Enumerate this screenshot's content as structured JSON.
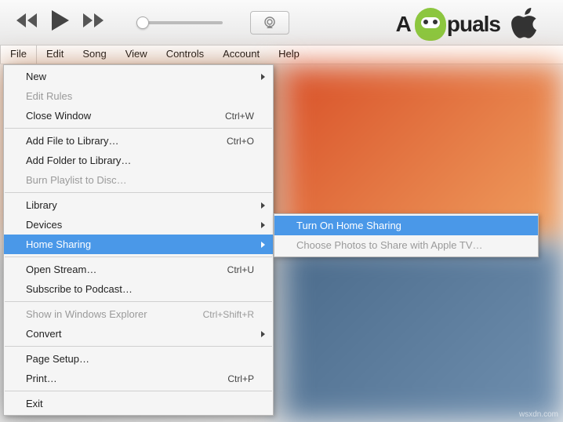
{
  "watermark": "wsxdn.com",
  "brand": {
    "name": "Appuals"
  },
  "menubar": {
    "items": [
      {
        "label": "File",
        "active": true
      },
      {
        "label": "Edit"
      },
      {
        "label": "Song"
      },
      {
        "label": "View"
      },
      {
        "label": "Controls"
      },
      {
        "label": "Account"
      },
      {
        "label": "Help"
      }
    ]
  },
  "file_menu": {
    "items": [
      {
        "label": "New",
        "submenu": true
      },
      {
        "label": "Edit Rules",
        "disabled": true
      },
      {
        "label": "Close Window",
        "shortcut": "Ctrl+W"
      },
      {
        "sep": true
      },
      {
        "label": "Add File to Library…",
        "shortcut": "Ctrl+O"
      },
      {
        "label": "Add Folder to Library…"
      },
      {
        "label": "Burn Playlist to Disc…",
        "disabled": true
      },
      {
        "sep": true
      },
      {
        "label": "Library",
        "submenu": true
      },
      {
        "label": "Devices",
        "submenu": true
      },
      {
        "label": "Home Sharing",
        "submenu": true,
        "highlight": true
      },
      {
        "sep": true
      },
      {
        "label": "Open Stream…",
        "shortcut": "Ctrl+U"
      },
      {
        "label": "Subscribe to Podcast…"
      },
      {
        "sep": true
      },
      {
        "label": "Show in Windows Explorer",
        "shortcut": "Ctrl+Shift+R",
        "disabled": true
      },
      {
        "label": "Convert",
        "submenu": true
      },
      {
        "sep": true
      },
      {
        "label": "Page Setup…"
      },
      {
        "label": "Print…",
        "shortcut": "Ctrl+P"
      },
      {
        "sep": true
      },
      {
        "label": "Exit"
      }
    ]
  },
  "submenu": {
    "items": [
      {
        "label": "Turn On Home Sharing",
        "highlight": true
      },
      {
        "label": "Choose Photos to Share with Apple TV…",
        "disabled": true
      }
    ]
  }
}
